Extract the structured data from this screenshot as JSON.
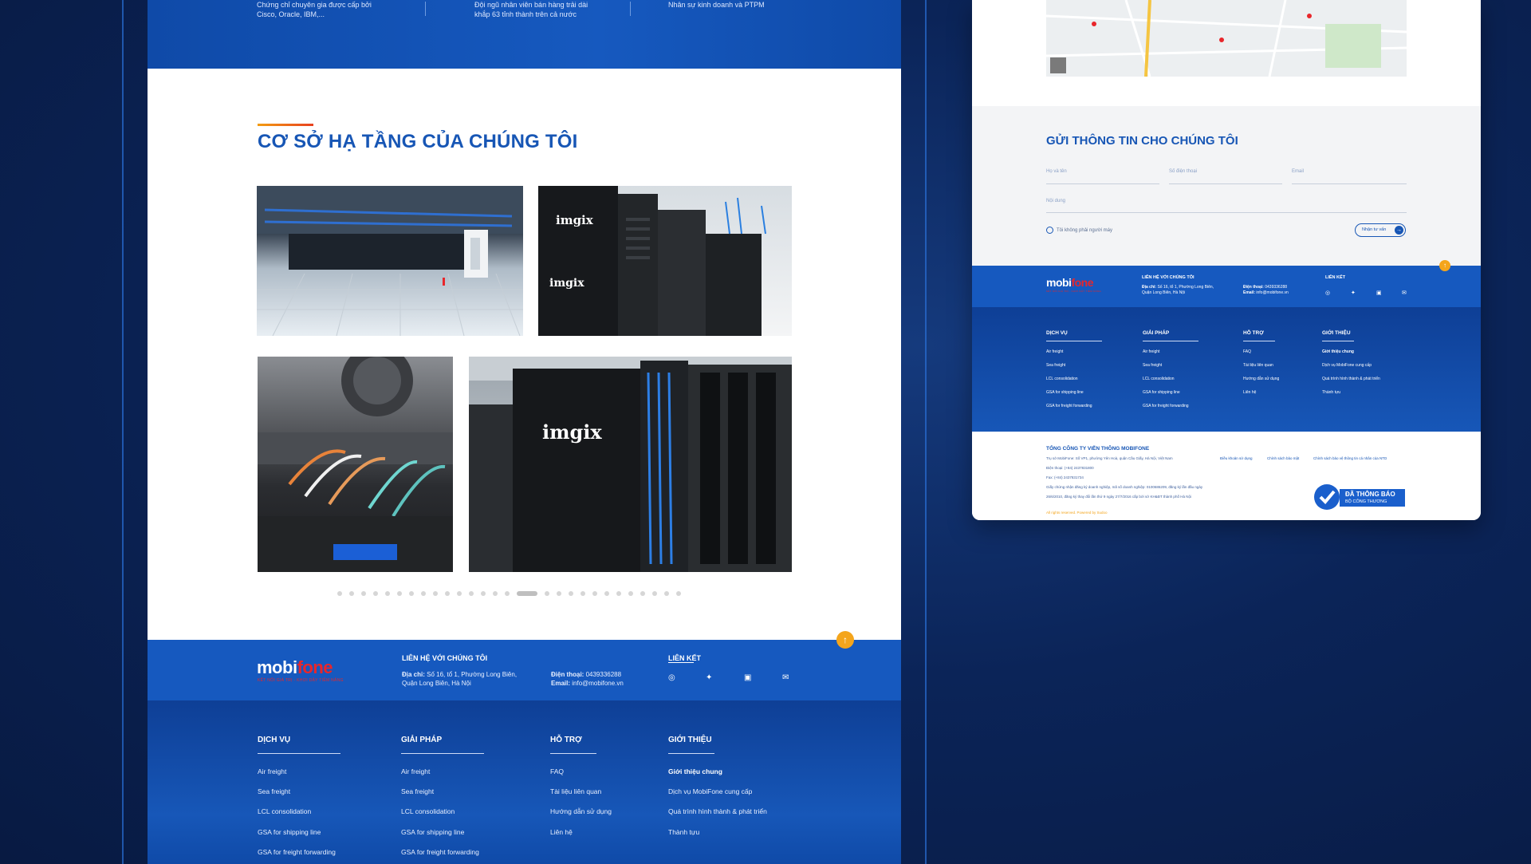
{
  "stats": [
    {
      "line1": "Chứng chỉ chuyên gia được cấp bởi",
      "line2": "Cisco, Oracle, IBM,..."
    },
    {
      "line1": "Đội ngũ nhân viên bán hàng trải dài",
      "line2": "khắp 63 tỉnh thành trên cả nước"
    },
    {
      "line1": "Nhân sự kinh doanh và PTPM",
      "line2": ""
    }
  ],
  "infrastructure": {
    "title": "CƠ SỞ HẠ TẦNG CỦA CHÚNG TÔI",
    "rack_brand": "imgix"
  },
  "carousel": {
    "dot_count": 28,
    "active_index": 15
  },
  "brand": {
    "logo_main": "mobi",
    "logo_accent": "fone",
    "tagline": "KẾT NỐI GIÁ TRỊ - KHƠI DẬY TIỀM NĂNG",
    "accent_color": "#e8262b",
    "primary_color": "#1659bf"
  },
  "contact": {
    "title": "LIÊN HỆ VỚI CHÚNG TÔI",
    "address_label": "Địa chỉ:",
    "address_line1": "Số 16, tổ 1, Phường Long Biên,",
    "address_line2": "Quận Long Biên, Hà Nội",
    "phone_label": "Điện thoại:",
    "phone": "0439336288",
    "email_label": "Email:",
    "email": "info@mobifone.vn",
    "links_title": "LIÊN KẾT",
    "socials": [
      "instagram-icon",
      "twitter-icon",
      "facebook-icon",
      "mail-icon"
    ]
  },
  "footer": {
    "columns": [
      {
        "title": "DỊCH VỤ",
        "items": [
          "Air freight",
          "Sea freight",
          "LCL consolidation",
          "GSA for shipping line",
          "GSA for freight forwarding"
        ]
      },
      {
        "title": "GIẢI PHÁP",
        "items": [
          "Air freight",
          "Sea freight",
          "LCL consolidation",
          "GSA for shipping line",
          "GSA for freight forwarding"
        ]
      },
      {
        "title": "HỖ TRỢ",
        "items": [
          "FAQ",
          "Tài liệu liên quan",
          "Hướng dẫn sử dụng",
          "Liên hệ"
        ]
      },
      {
        "title": "GIỚI THIỆU",
        "items": [
          "Giới thiệu chung",
          "Dịch vụ MobiFone cung cấp",
          "Quá trình hình thành & phát triển",
          "Thành tựu"
        ]
      }
    ]
  },
  "form": {
    "title": "GỬI THÔNG TIN CHO CHÚNG TÔI",
    "name_placeholder": "Họ và tên",
    "phone_placeholder": "Số điện thoại",
    "email_placeholder": "Email",
    "message_placeholder": "Nội dung",
    "checkbox_label": "Tôi không phải người máy",
    "submit_label": "Nhận tư vấn"
  },
  "company": {
    "name": "TỔNG CÔNG TY VIỄN THÔNG MOBIFONE",
    "lines": [
      "Trụ sở MobiFone: Số VP1, phường Yên Hoà, quận Cầu Giấy, Hà Nội, Việt Nam",
      "Điện thoại: (+84) 2437831800",
      "Fax: (+84) 2437831734",
      "Giấy chứng nhận đăng ký doanh nghiệp, mã số doanh nghiệp: 0100686209, đăng ký lần đầu ngày",
      "26/6/2010, đăng ký thay đổi lần thứ 9 ngày 27/7/2016 cấp bởi sở KH&ĐT thành phố Hà Nội"
    ],
    "policies": [
      "Điều khoản sử dụng",
      "Chính sách bảo mật",
      "Chính sách bảo vệ thông tin cá nhân của NTD"
    ],
    "copyright": "All rights reserved. Powered by Sudoo",
    "badge_line1": "ĐÃ THÔNG BÁO",
    "badge_line2": "BỘ CÔNG THƯƠNG"
  }
}
